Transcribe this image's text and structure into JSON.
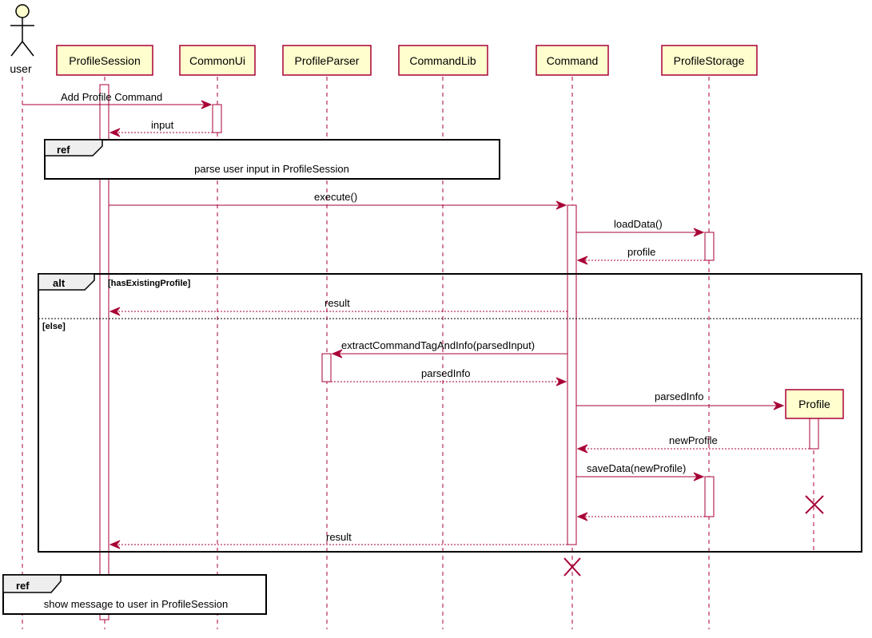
{
  "diagram": {
    "type": "sequence",
    "actor": {
      "label": "user"
    },
    "participants": [
      {
        "id": "ProfileSession",
        "label": "ProfileSession"
      },
      {
        "id": "CommonUi",
        "label": "CommonUi"
      },
      {
        "id": "ProfileParser",
        "label": "ProfileParser"
      },
      {
        "id": "CommandLib",
        "label": "CommandLib"
      },
      {
        "id": "Command",
        "label": "Command"
      },
      {
        "id": "ProfileStorage",
        "label": "ProfileStorage"
      },
      {
        "id": "Profile",
        "label": "Profile",
        "created": true
      }
    ],
    "messages": [
      {
        "from": "user",
        "to": "CommonUi",
        "label": "Add Profile Command",
        "kind": "sync"
      },
      {
        "from": "CommonUi",
        "to": "ProfileSession",
        "label": "input",
        "kind": "return"
      },
      {
        "from": "ProfileSession",
        "to": "Command",
        "label": "execute()",
        "kind": "sync"
      },
      {
        "from": "Command",
        "to": "ProfileStorage",
        "label": "loadData()",
        "kind": "sync"
      },
      {
        "from": "ProfileStorage",
        "to": "Command",
        "label": "profile",
        "kind": "return"
      },
      {
        "from": "Command",
        "to": "ProfileSession",
        "label": "result",
        "kind": "return",
        "fragment": "alt:if"
      },
      {
        "from": "Command",
        "to": "ProfileParser",
        "label": "extractCommandTagAndInfo(parsedInput)",
        "kind": "sync",
        "fragment": "alt:else"
      },
      {
        "from": "ProfileParser",
        "to": "Command",
        "label": "parsedInfo",
        "kind": "return",
        "fragment": "alt:else"
      },
      {
        "from": "Command",
        "to": "Profile",
        "label": "parsedInfo",
        "kind": "create",
        "fragment": "alt:else"
      },
      {
        "from": "Profile",
        "to": "Command",
        "label": "newProfile",
        "kind": "return",
        "fragment": "alt:else"
      },
      {
        "from": "Command",
        "to": "ProfileStorage",
        "label": "saveData(newProfile)",
        "kind": "sync",
        "fragment": "alt:else"
      },
      {
        "from": "ProfileStorage",
        "to": "Command",
        "label": "",
        "kind": "return",
        "fragment": "alt:else"
      },
      {
        "from": "Command",
        "to": "ProfileSession",
        "label": "result",
        "kind": "return",
        "fragment": "alt:else"
      }
    ],
    "refs": [
      {
        "tag": "ref",
        "text": "parse user input in ProfileSession"
      },
      {
        "tag": "ref",
        "text": "show message to user in ProfileSession"
      }
    ],
    "alt": {
      "tag": "alt",
      "guard_if": "[hasExistingProfile]",
      "guard_else": "[else]"
    },
    "destroyed": [
      "Profile",
      "Command"
    ]
  },
  "colors": {
    "participant_fill": "#fefece",
    "line": "#a80036",
    "frame": "#000000",
    "tab_fill": "#eeeeee"
  }
}
